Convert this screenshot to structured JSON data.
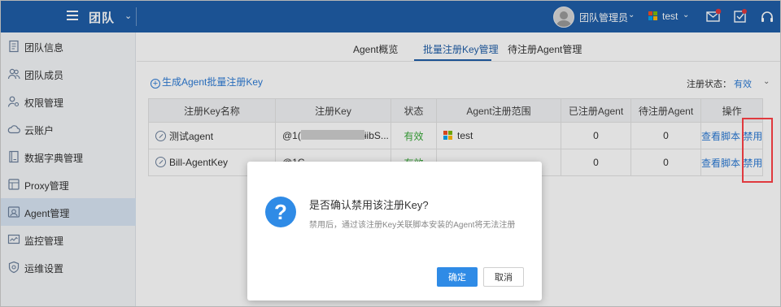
{
  "header": {
    "team_title": "团队",
    "user_name": "团队管理员",
    "tenant_name": "test"
  },
  "sidebar": {
    "items": [
      {
        "label": "团队信息",
        "icon": "document-icon"
      },
      {
        "label": "团队成员",
        "icon": "users-icon"
      },
      {
        "label": "权限管理",
        "icon": "user-key-icon"
      },
      {
        "label": "云账户",
        "icon": "cloud-icon"
      },
      {
        "label": "数据字典管理",
        "icon": "book-icon"
      },
      {
        "label": "Proxy管理",
        "icon": "proxy-icon"
      },
      {
        "label": "Agent管理",
        "icon": "agent-icon",
        "active": true
      },
      {
        "label": "监控管理",
        "icon": "monitor-icon"
      },
      {
        "label": "运维设置",
        "icon": "shield-gear-icon"
      }
    ]
  },
  "tabs": [
    {
      "label": "Agent概览"
    },
    {
      "label": "批量注册Key管理",
      "active": true
    },
    {
      "label": "待注册Agent管理"
    }
  ],
  "toolbar": {
    "generate_link": "生成Agent批量注册Key",
    "status_filter_label": "注册状态：",
    "status_filter_value": "有效"
  },
  "table": {
    "headers": [
      "注册Key名称",
      "注册Key",
      "状态",
      "Agent注册范围",
      "已注册Agent",
      "待注册Agent",
      "操作"
    ],
    "rows": [
      {
        "name": "测试agent",
        "key_prefix": "@1(",
        "key_suffix": "ɨibS...",
        "status": "有效",
        "scope": "test",
        "registered": "0",
        "pending": "0",
        "action_view": "查看脚本",
        "action_disable": "禁用"
      },
      {
        "name": "Bill-AgentKey",
        "key_prefix": "@1C",
        "key_suffix": "",
        "status": "有效",
        "scope": "",
        "registered": "0",
        "pending": "0",
        "action_view": "查看脚本",
        "action_disable": "禁用"
      }
    ]
  },
  "dialog": {
    "title": "是否确认禁用该注册Key?",
    "description": "禁用后，通过该注册Key关联脚本安装的Agent将无法注册",
    "ok_label": "确定",
    "cancel_label": "取消",
    "icon": "question-icon"
  },
  "colors": {
    "topbar": "#1f5ea8",
    "link": "#2d7bd5",
    "status_valid": "#3aa93a",
    "highlight": "#e0393e",
    "primary_button": "#2f8be6"
  }
}
